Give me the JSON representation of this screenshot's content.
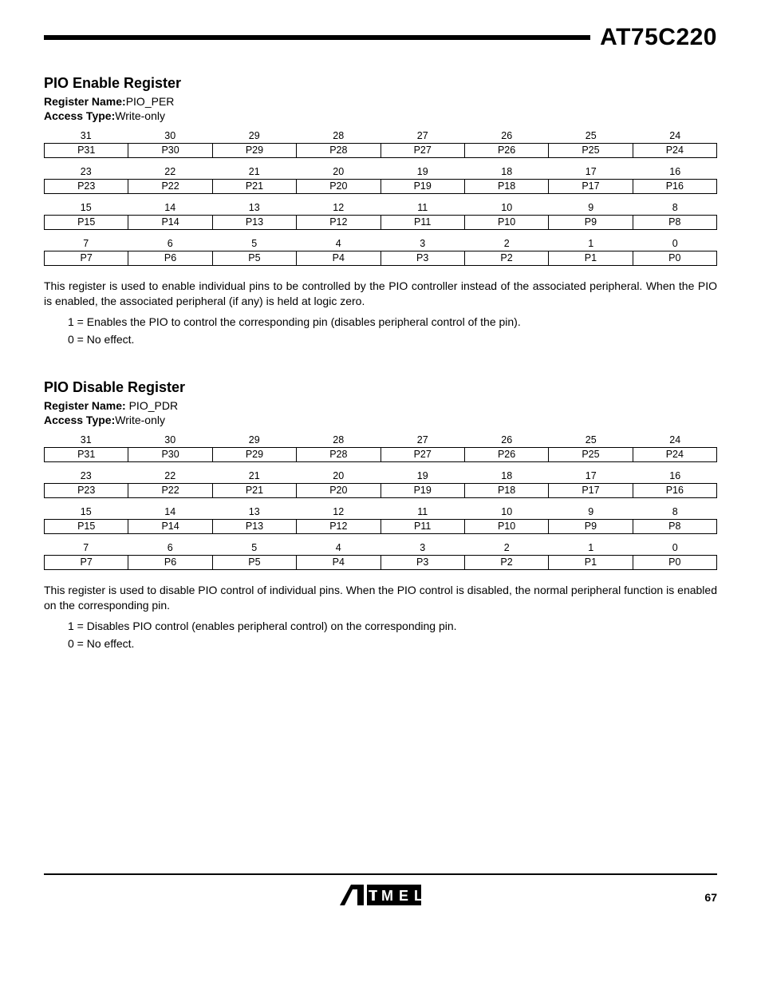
{
  "chip_name": "AT75C220",
  "page_number": "67",
  "sections": [
    {
      "title": "PIO Enable Register",
      "reg_name_label": "Register Name:",
      "reg_name_value": "PIO_PER",
      "access_label": "Access Type:",
      "access_value": "Write-only",
      "rows": [
        {
          "bits": [
            "31",
            "30",
            "29",
            "28",
            "27",
            "26",
            "25",
            "24"
          ],
          "names": [
            "P31",
            "P30",
            "P29",
            "P28",
            "P27",
            "P26",
            "P25",
            "P24"
          ]
        },
        {
          "bits": [
            "23",
            "22",
            "21",
            "20",
            "19",
            "18",
            "17",
            "16"
          ],
          "names": [
            "P23",
            "P22",
            "P21",
            "P20",
            "P19",
            "P18",
            "P17",
            "P16"
          ]
        },
        {
          "bits": [
            "15",
            "14",
            "13",
            "12",
            "11",
            "10",
            "9",
            "8"
          ],
          "names": [
            "P15",
            "P14",
            "P13",
            "P12",
            "P11",
            "P10",
            "P9",
            "P8"
          ]
        },
        {
          "bits": [
            "7",
            "6",
            "5",
            "4",
            "3",
            "2",
            "1",
            "0"
          ],
          "names": [
            "P7",
            "P6",
            "P5",
            "P4",
            "P3",
            "P2",
            "P1",
            "P0"
          ]
        }
      ],
      "desc": "This register is used to enable individual pins to be controlled by the PIO controller instead of the associated peripheral. When the PIO is enabled, the associated peripheral (if any) is held at logic zero.",
      "line1": "1 = Enables the PIO to control the corresponding pin (disables peripheral control of the pin).",
      "line0": "0 = No effect."
    },
    {
      "title": "PIO Disable Register",
      "reg_name_label": "Register Name: ",
      "reg_name_value": "PIO_PDR",
      "access_label": "Access Type:",
      "access_value": "Write-only",
      "rows": [
        {
          "bits": [
            "31",
            "30",
            "29",
            "28",
            "27",
            "26",
            "25",
            "24"
          ],
          "names": [
            "P31",
            "P30",
            "P29",
            "P28",
            "P27",
            "P26",
            "P25",
            "P24"
          ]
        },
        {
          "bits": [
            "23",
            "22",
            "21",
            "20",
            "19",
            "18",
            "17",
            "16"
          ],
          "names": [
            "P23",
            "P22",
            "P21",
            "P20",
            "P19",
            "P18",
            "P17",
            "P16"
          ]
        },
        {
          "bits": [
            "15",
            "14",
            "13",
            "12",
            "11",
            "10",
            "9",
            "8"
          ],
          "names": [
            "P15",
            "P14",
            "P13",
            "P12",
            "P11",
            "P10",
            "P9",
            "P8"
          ]
        },
        {
          "bits": [
            "7",
            "6",
            "5",
            "4",
            "3",
            "2",
            "1",
            "0"
          ],
          "names": [
            "P7",
            "P6",
            "P5",
            "P4",
            "P3",
            "P2",
            "P1",
            "P0"
          ]
        }
      ],
      "desc": "This register is used to disable PIO control of individual pins. When the PIO control is disabled, the normal peripheral function is enabled on the corresponding pin.",
      "line1": "1 = Disables PIO control (enables peripheral control) on the corresponding pin.",
      "line0": "0 = No effect."
    }
  ]
}
